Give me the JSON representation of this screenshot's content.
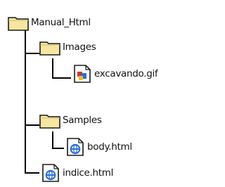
{
  "tree": {
    "root": {
      "label": "Manual_Html",
      "icon": "folder-icon"
    },
    "images": {
      "label": "Images",
      "icon": "folder-icon"
    },
    "gif": {
      "label": "excavando.gif",
      "icon": "gif-image-file-icon"
    },
    "samples": {
      "label": "Samples",
      "icon": "folder-icon"
    },
    "body": {
      "label": "body.html",
      "icon": "html-file-icon"
    },
    "indice": {
      "label": "indice.html",
      "icon": "html-file-icon"
    }
  },
  "colors": {
    "folder_fill": "#f7e6a1",
    "folder_stroke": "#1a1a1a",
    "tree_lines": "#000000",
    "html_icon_blue": "#2f6fd1"
  }
}
